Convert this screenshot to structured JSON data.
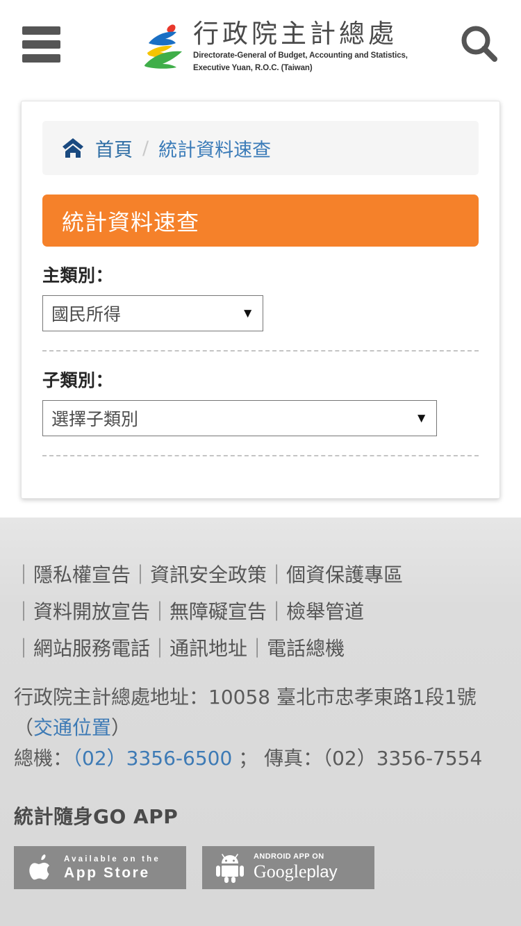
{
  "header": {
    "menu_icon": "hamburger-menu-icon",
    "search_icon": "search-icon",
    "logo_title_cn": "行政院主計總處",
    "logo_subtitle_line1": "Directorate-General of Budget, Accounting and Statistics,",
    "logo_subtitle_line2": "Executive Yuan, R.O.C. (Taiwan)"
  },
  "breadcrumb": {
    "home_icon": "home-icon",
    "home_label": "首頁",
    "separator": "/",
    "current": "統計資料速查"
  },
  "page": {
    "banner_title": "統計資料速查",
    "banner_color": "#f5812a"
  },
  "form": {
    "main_category": {
      "label": "主類別：",
      "value": "國民所得",
      "caret": "▼"
    },
    "sub_category": {
      "label": "子類別：",
      "value": "選擇子類別",
      "caret": "▼"
    }
  },
  "footer": {
    "link_rows": [
      {
        "items": [
          "隱私權宣告",
          "資訊安全政策",
          "個資保護專區"
        ]
      },
      {
        "items": [
          "資料開放宣告",
          "無障礙宣告",
          "檢舉管道"
        ]
      },
      {
        "items": [
          "網站服務電話",
          "通訊地址",
          "電話總機"
        ]
      }
    ],
    "bar": "｜",
    "address_prefix": "行政院主計總處地址：10058 臺北市忠孝東路1段1號（",
    "address_link": "交通位置",
    "address_suffix": "）",
    "phone_prefix": "總機：",
    "phone_link": "（02）3356-6500",
    "phone_mid": " ； 傳真：（02）3356-7554",
    "app_title": "統計隨身GO APP",
    "ios_badge": {
      "line1": "Available on the",
      "line2": "App Store",
      "icon": "apple-icon"
    },
    "google_badge": {
      "line1": "ANDROID APP ON",
      "line2_google": "Google",
      "line2_play": "play",
      "icon": "android-icon"
    },
    "badge_bg": "#8a8a8a"
  }
}
